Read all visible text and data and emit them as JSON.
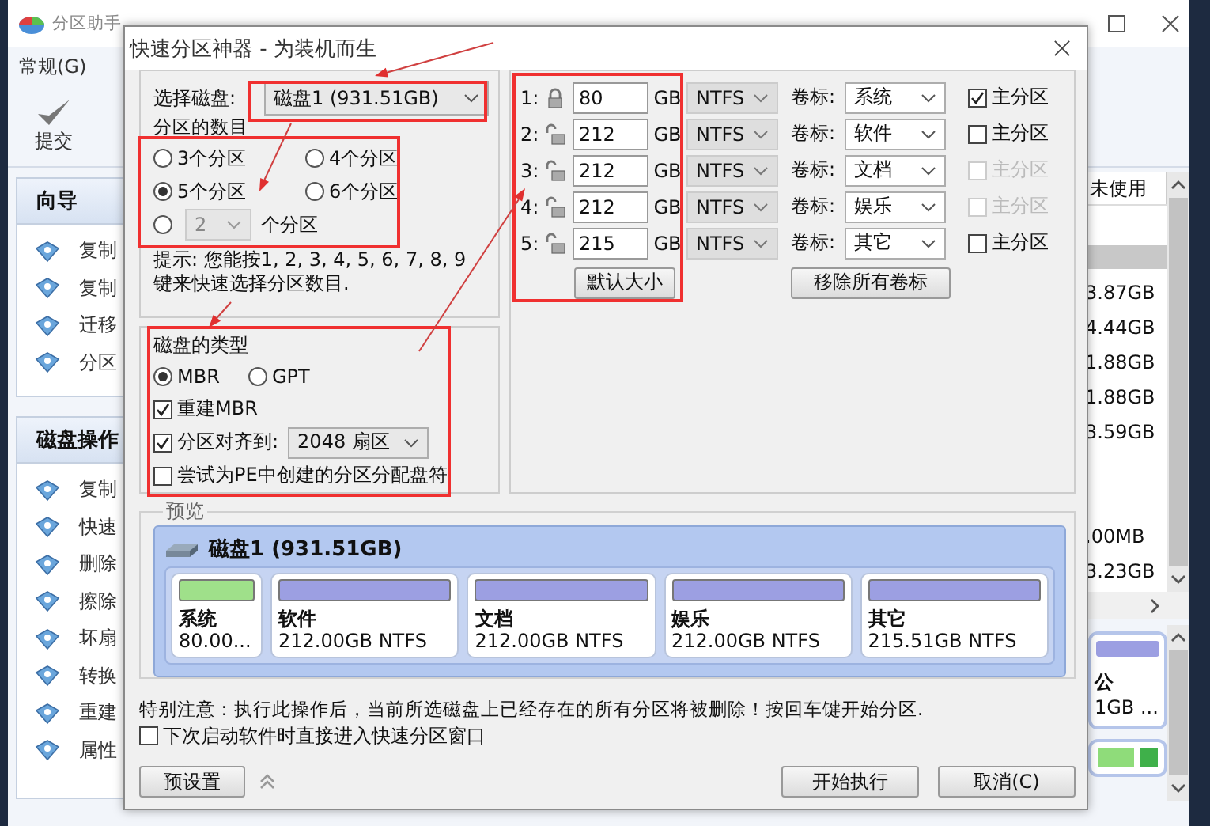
{
  "app": {
    "title": "分区助手",
    "menu": [
      {
        "label": "常规(G)"
      }
    ],
    "toolbar": [
      {
        "label": "提交"
      }
    ],
    "sidebar": [
      {
        "title": "向导",
        "items": [
          "复制",
          "复制",
          "迁移",
          "分区"
        ]
      },
      {
        "title": "磁盘操作",
        "items": [
          "复制",
          "快速",
          "删除",
          "擦除",
          "坏扇",
          "转换",
          "重建",
          "属性"
        ]
      }
    ],
    "table": {
      "columns": [
        "未使用"
      ],
      "rows": [
        {
          "selected": false
        },
        {
          "selected": true
        },
        {
          "value": "3.87GB",
          "selected": false
        },
        {
          "value": "4.44GB",
          "selected": false
        },
        {
          "value": "1.88GB",
          "selected": false
        },
        {
          "value": "1.88GB",
          "selected": false
        },
        {
          "value": "3.59GB",
          "selected": false
        },
        {
          "selected": false
        },
        {
          "selected": false
        },
        {
          "value": ".00MB",
          "selected": false
        },
        {
          "value": "3.23GB",
          "selected": false
        }
      ]
    },
    "disk_map": {
      "cards": [
        {
          "name": "公",
          "detail": "1GB ..."
        }
      ]
    }
  },
  "dialog": {
    "title": "快速分区神器 - 为装机而生",
    "disk_select": {
      "label": "选择磁盘:",
      "value": "磁盘1 (931.51GB)"
    },
    "count": {
      "label": "分区的数目",
      "options": [
        {
          "label": "3个分区",
          "selected": false
        },
        {
          "label": "4个分区",
          "selected": false
        },
        {
          "label": "5个分区",
          "selected": true
        },
        {
          "label": "6个分区",
          "selected": false
        }
      ],
      "custom": {
        "selected": false,
        "value": "2",
        "disabled": true,
        "suffix": "个分区"
      },
      "hint": "提示: 您能按1, 2, 3, 4, 5, 6, 7, 8, 9键来快速选择分区数目."
    },
    "disk_type": {
      "label": "磁盘的类型",
      "options": [
        {
          "label": "MBR",
          "selected": true
        },
        {
          "label": "GPT",
          "selected": false
        }
      ],
      "rebuild_mbr": {
        "label": "重建MBR",
        "checked": true
      },
      "align": {
        "label": "分区对齐到:",
        "checked": true,
        "value": "2048 扇区"
      },
      "assign_letter": {
        "label": "尝试为PE中创建的分区分配盘符",
        "checked": false
      }
    },
    "partitions": [
      {
        "index": "1:",
        "locked": true,
        "size": "80",
        "unit": "GB",
        "fs": "NTFS",
        "caption": "卷标:",
        "label": "系统",
        "primary": {
          "label": "主分区",
          "checked": true,
          "disabled": false
        }
      },
      {
        "index": "2:",
        "locked": false,
        "size": "212",
        "unit": "GB",
        "fs": "NTFS",
        "caption": "卷标:",
        "label": "软件",
        "primary": {
          "label": "主分区",
          "checked": false,
          "disabled": false
        }
      },
      {
        "index": "3:",
        "locked": false,
        "size": "212",
        "unit": "GB",
        "fs": "NTFS",
        "caption": "卷标:",
        "label": "文档",
        "primary": {
          "label": "主分区",
          "checked": false,
          "disabled": true
        }
      },
      {
        "index": "4:",
        "locked": false,
        "size": "212",
        "unit": "GB",
        "fs": "NTFS",
        "caption": "卷标:",
        "label": "娱乐",
        "primary": {
          "label": "主分区",
          "checked": false,
          "disabled": true
        }
      },
      {
        "index": "5:",
        "locked": false,
        "size": "215",
        "unit": "GB",
        "fs": "NTFS",
        "caption": "卷标:",
        "label": "其它",
        "primary": {
          "label": "主分区",
          "checked": false,
          "disabled": false
        }
      }
    ],
    "default_size_button": "默认大小",
    "remove_labels_button": "移除所有卷标",
    "preview": {
      "legend": "预览",
      "disk": "磁盘1 (931.51GB)",
      "cards": [
        {
          "name": "系统",
          "detail": "80.00...",
          "color": "#9fe08a"
        },
        {
          "name": "软件",
          "detail": "212.00GB NTFS",
          "color": "#9c9fe2"
        },
        {
          "name": "文档",
          "detail": "212.00GB NTFS",
          "color": "#9c9fe2"
        },
        {
          "name": "娱乐",
          "detail": "212.00GB NTFS",
          "color": "#9c9fe2"
        },
        {
          "name": "其它",
          "detail": "215.51GB NTFS",
          "color": "#9c9fe2"
        }
      ]
    },
    "notice": "特别注意：执行此操作后，当前所选磁盘上已经存在的所有分区将被删除！按回车键开始分区.",
    "startup_checkbox": {
      "label": "下次启动软件时直接进入快速分区窗口",
      "checked": false
    },
    "buttons": {
      "presets": "预设置",
      "start": "开始执行",
      "cancel": "取消(C)"
    }
  }
}
